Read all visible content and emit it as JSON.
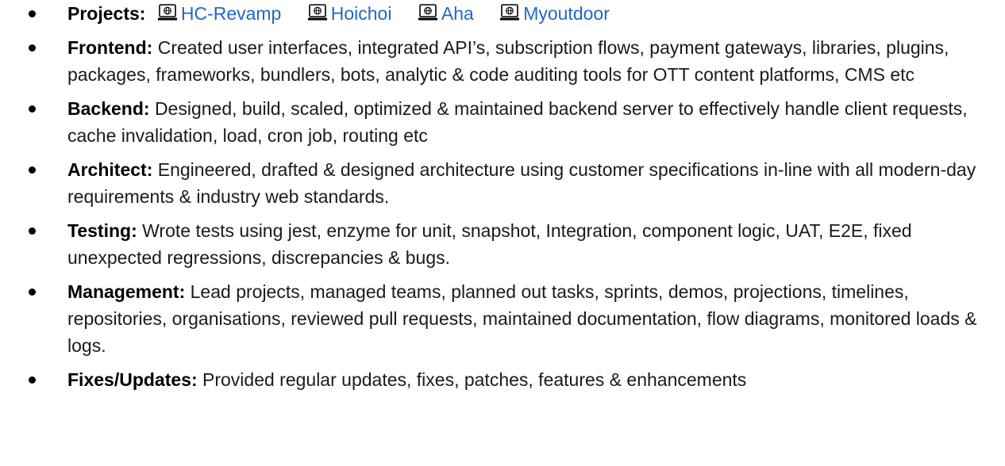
{
  "items": [
    {
      "key": "Projects:",
      "projects": [
        "HC-Revamp",
        "Hoichoi",
        "Aha",
        "Myoutdoor"
      ]
    },
    {
      "key": "Frontend:",
      "text": "Created user interfaces, integrated API’s, subscription flows, payment gateways, libraries, plugins, packages, frameworks, bundlers, bots, analytic & code auditing tools for OTT content platforms, CMS etc"
    },
    {
      "key": "Backend:",
      "text": "Designed, build, scaled, optimized & maintained backend server to effectively handle client requests, cache invalidation, load, cron job, routing etc"
    },
    {
      "key": "Architect:",
      "text": "Engineered, drafted & designed architecture using customer specifications in-line with all modern-day requirements & industry web standards."
    },
    {
      "key": "Testing:",
      "text": "Wrote tests using jest, enzyme for unit, snapshot, Integration, component logic, UAT, E2E, fixed unexpected regressions, discrepancies & bugs."
    },
    {
      "key": "Management:",
      "text": "Lead projects, managed teams, planned out tasks, sprints, demos, projections, timelines, repositories, organisations, reviewed pull requests, maintained documentation, flow diagrams, monitored loads & logs."
    },
    {
      "key": "Fixes/Updates:",
      "text": "Provided regular updates, fixes, patches, features & enhancements"
    }
  ],
  "colors": {
    "link": "#1f68c7",
    "text": "#1a1a1a"
  },
  "icons": {
    "project_link_icon": "laptop-web-icon"
  }
}
